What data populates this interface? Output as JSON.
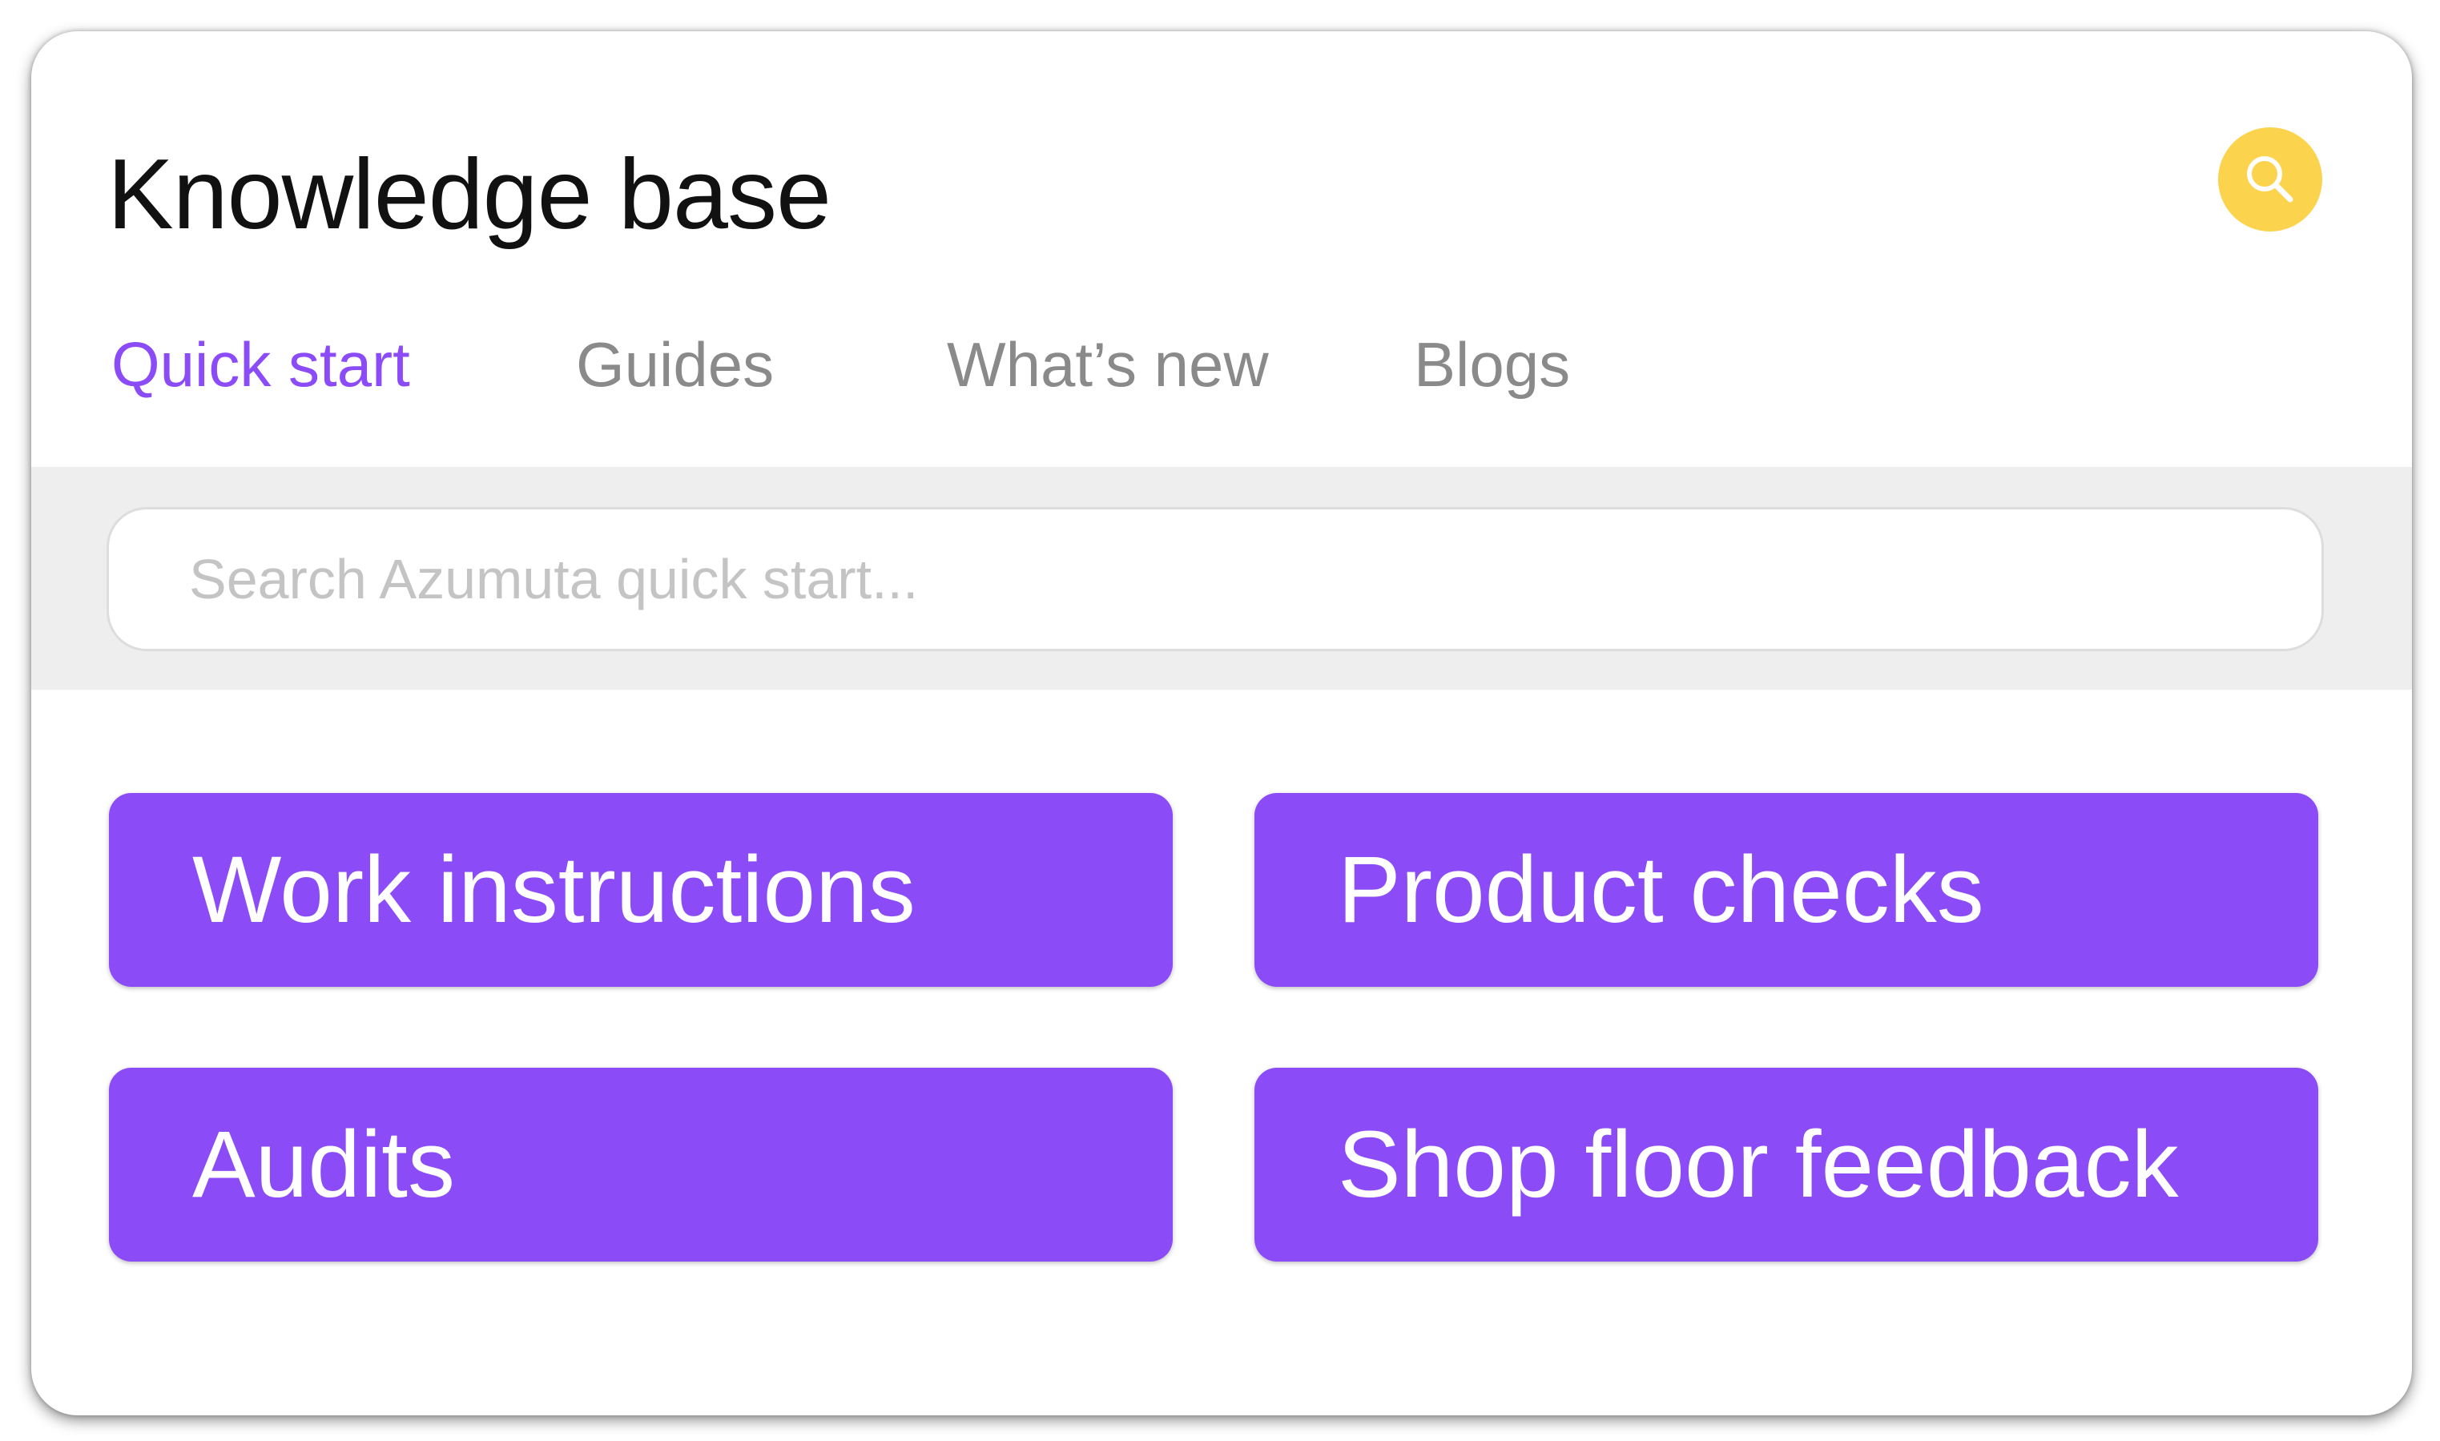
{
  "header": {
    "title": "Knowledge base",
    "search_icon": "search-icon",
    "search_button_color": "#fcd34d"
  },
  "tabs": [
    {
      "label": "Quick start",
      "active": true
    },
    {
      "label": "Guides",
      "active": false
    },
    {
      "label": "What’s new",
      "active": false
    },
    {
      "label": "Blogs",
      "active": false
    }
  ],
  "search": {
    "placeholder": "Search Azumuta quick start...",
    "value": ""
  },
  "categories": [
    {
      "label": "Work instructions"
    },
    {
      "label": "Product checks"
    },
    {
      "label": "Audits"
    },
    {
      "label": "Shop floor feedback"
    }
  ],
  "colors": {
    "accent": "#8b4cf7",
    "tab_inactive": "#8a8a8a",
    "band": "#eeeeee"
  }
}
